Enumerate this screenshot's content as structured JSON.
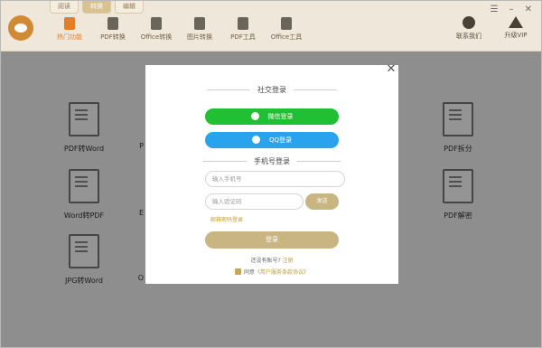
{
  "top_tabs": [
    "阅读",
    "转换",
    "编辑"
  ],
  "nav": [
    {
      "label": "热门功能",
      "icon": "hot-icon"
    },
    {
      "label": "PDF转换",
      "icon": "pdf-icon"
    },
    {
      "label": "Office转换",
      "icon": "office-icon"
    },
    {
      "label": "图片转换",
      "icon": "image-icon"
    },
    {
      "label": "PDF工具",
      "icon": "toolbox-icon"
    },
    {
      "label": "Office工具",
      "icon": "office-tools-icon"
    }
  ],
  "right_actions": {
    "contact": "联系我们",
    "vip": "升级VIP"
  },
  "window_buttons": [
    "☰",
    "–",
    "✕"
  ],
  "tools": {
    "pdf_to_word": "PDF转Word",
    "word_to_pdf": "Word转PDF",
    "jpg_to_word": "JPG转Word",
    "pdf_split": "PDF拆分",
    "pdf_decrypt": "PDF解密",
    "partial_mid1": "P",
    "partial_mid2": "E",
    "partial_mid3": "O"
  },
  "modal": {
    "close": "✕",
    "social_title": "社交登录",
    "wechat_label": "微信登录",
    "qq_label": "QQ登录",
    "phone_title": "手机号登录",
    "phone_placeholder": "输入手机号",
    "code_placeholder": "输入验证码",
    "send_label": "发送",
    "email_link": "邮箱密码登录",
    "login_label": "登录",
    "no_account": "还没有账号?",
    "register_link": "注册",
    "agree_text": "同意",
    "terms_link": "《用户服务条款协议》"
  },
  "colors": {
    "accent_gold": "#c9b582",
    "wechat_green": "#20bf34",
    "qq_blue": "#2ba3ec",
    "active_orange": "#e27d2a"
  }
}
